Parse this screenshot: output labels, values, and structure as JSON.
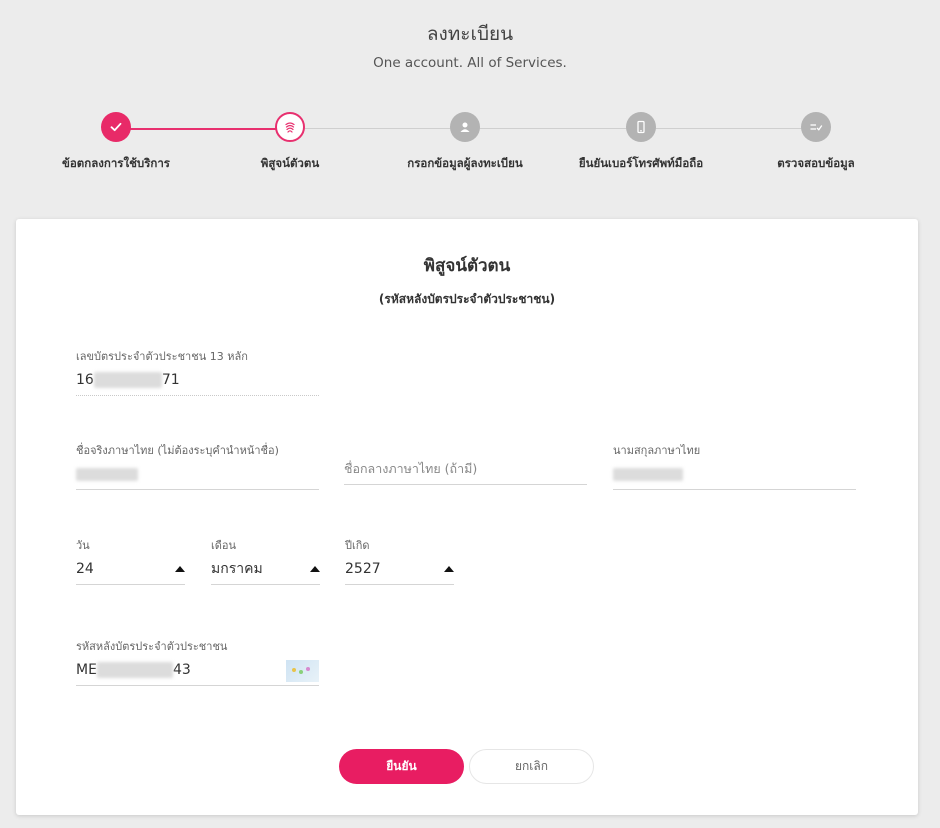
{
  "header": {
    "title": "ลงทะเบียน",
    "subtitle": "One account. All of Services."
  },
  "stepper": {
    "steps": [
      {
        "label": "ข้อตกลงการใช้บริการ",
        "state": "done",
        "icon": "check-icon"
      },
      {
        "label": "พิสูจน์ตัวตน",
        "state": "active",
        "icon": "fingerprint-icon"
      },
      {
        "label": "กรอกข้อมูลผู้ลงทะเบียน",
        "state": "todo",
        "icon": "person-icon"
      },
      {
        "label": "ยืนยันเบอร์โทรศัพท์มือถือ",
        "state": "todo",
        "icon": "mobile-phone-icon"
      },
      {
        "label": "ตรวจสอบข้อมูล",
        "state": "todo",
        "icon": "checklist-icon"
      }
    ],
    "active_color": "#e82a68",
    "inactive_color": "#b3b3b3"
  },
  "form": {
    "title": "พิสูจน์ตัวตน",
    "subtitle": "(รหัสหลังบัตรประจำตัวประชาชน)",
    "id_number": {
      "label": "เลขบัตรประจำตัวประชาชน 13 หลัก",
      "value_start": "16",
      "value_end": "71"
    },
    "first_name": {
      "label": "ชื่อจริงภาษาไทย (ไม่ต้องระบุคำนำหน้าชื่อ)"
    },
    "middle_name": {
      "placeholder": "ชื่อกลางภาษาไทย (ถ้ามี)"
    },
    "last_name": {
      "label": "นามสกุลภาษาไทย"
    },
    "birth_day": {
      "label": "วัน",
      "value": "24"
    },
    "birth_month": {
      "label": "เดือน",
      "value": "มกราคม"
    },
    "birth_year": {
      "label": "ปีเกิด",
      "value": "2527"
    },
    "laser_code": {
      "label": "รหัสหลังบัตรประจำตัวประชาชน",
      "value_start": "ME",
      "value_end": "43"
    }
  },
  "buttons": {
    "confirm": "ยืนยัน",
    "cancel": "ยกเลิก"
  },
  "colors": {
    "accent": "#e81d62",
    "background": "#ececec"
  }
}
